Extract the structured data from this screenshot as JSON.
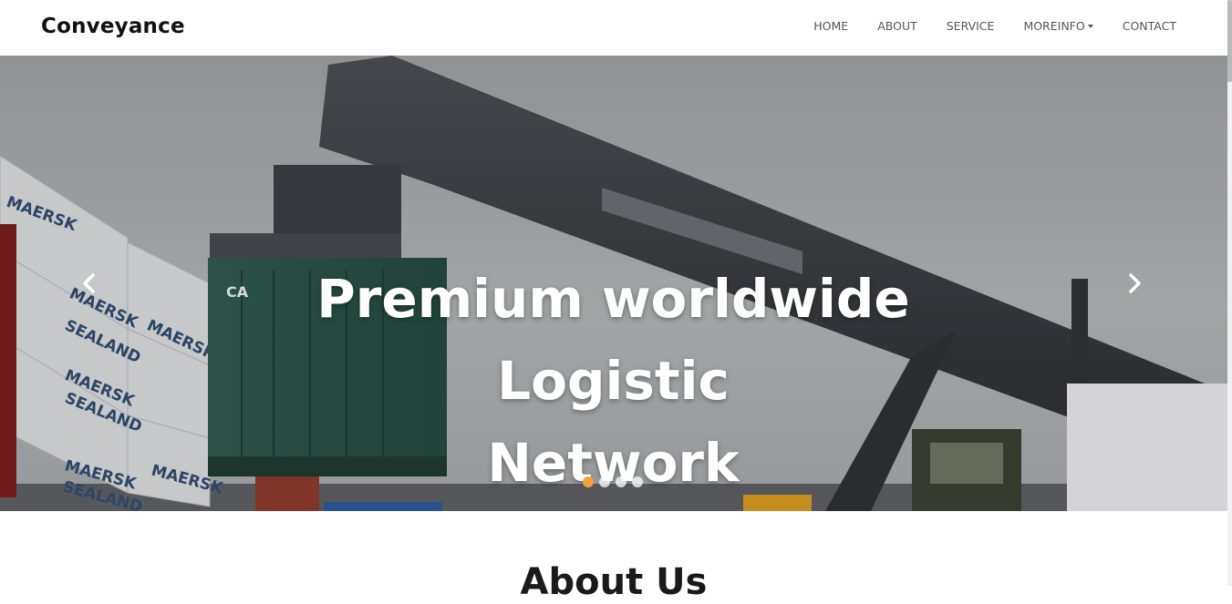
{
  "navbar": {
    "brand": "Conveyance",
    "links": [
      {
        "label": "HOME"
      },
      {
        "label": "ABOUT"
      },
      {
        "label": "SERVICE"
      },
      {
        "label": "MOREINFO",
        "dropdown": true
      },
      {
        "label": "CONTACT"
      }
    ]
  },
  "hero": {
    "title_line1": "Premium worldwide Logistic",
    "title_line2": "Network",
    "prev_icon": "chevron-left-icon",
    "next_icon": "chevron-right-icon",
    "slide_count": 4,
    "active_slide": 1,
    "photo_labels": {
      "maersk": "MAERSK",
      "sealand": "SEALAND",
      "container_brand": "CA"
    }
  },
  "about": {
    "heading": "About Us"
  },
  "colors": {
    "accent": "#f4a13e",
    "text_dark": "#111111",
    "nav_text": "#555555"
  }
}
